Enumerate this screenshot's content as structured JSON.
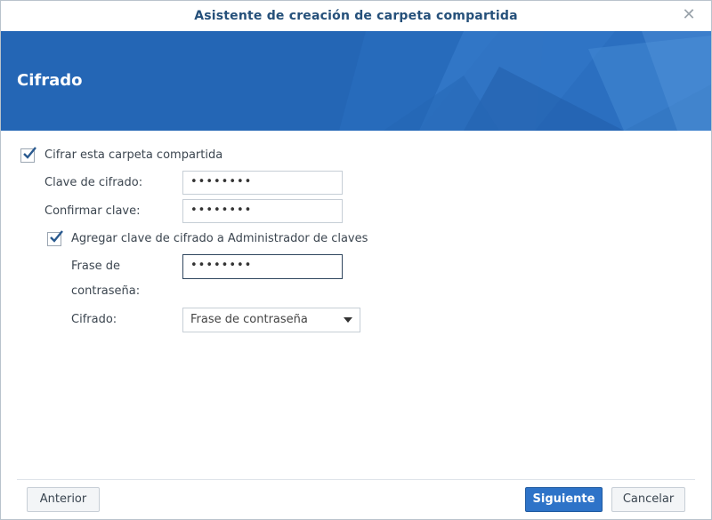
{
  "window": {
    "title": "Asistente de creación de carpeta compartida",
    "close_icon": "close-icon"
  },
  "banner": {
    "title": "Cifrado"
  },
  "form": {
    "encrypt_checkbox": {
      "label": "Cifrar esta carpeta compartida",
      "checked": true
    },
    "encryption_key": {
      "label": "Clave de cifrado:",
      "value": "••••••••"
    },
    "confirm_key": {
      "label": "Confirmar clave:",
      "value": "••••••••"
    },
    "key_manager_checkbox": {
      "label": "Agregar clave de cifrado a Administrador de claves",
      "checked": true
    },
    "passphrase": {
      "label_line1": "Frase de",
      "label_line2": "contraseña:",
      "value": "••••••••"
    },
    "encryption_type": {
      "label": "Cifrado:",
      "selected": "Frase de contraseña"
    }
  },
  "footer": {
    "back_label": "Anterior",
    "next_label": "Siguiente",
    "cancel_label": "Cancelar"
  },
  "colors": {
    "banner": "#2466b5",
    "primary_button": "#2e73c8",
    "title_text": "#25507a"
  }
}
